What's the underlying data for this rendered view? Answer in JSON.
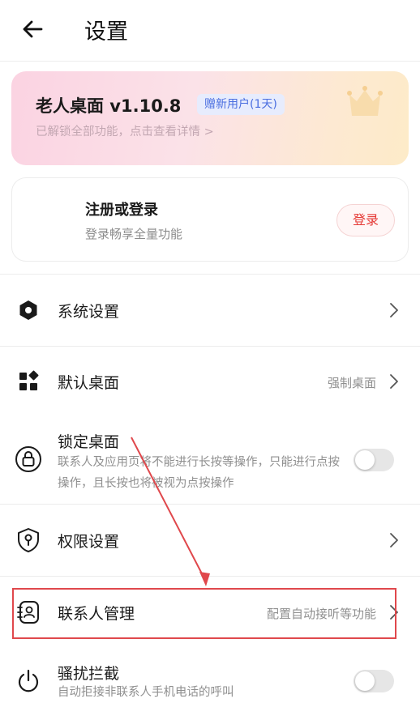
{
  "header": {
    "title": "设置",
    "back_icon": "arrow-left-icon"
  },
  "vip_card": {
    "title": "老人桌面 v1.10.8",
    "badge": "赠新用户(1天)",
    "subtitle": "已解锁全部功能，点击查看详情 >",
    "icon": "crown-icon"
  },
  "login_card": {
    "title": "注册或登录",
    "subtitle": "登录畅享全量功能",
    "button_label": "登录"
  },
  "settings": {
    "system": {
      "label": "系统设置",
      "icon": "hexagon-gear-icon"
    },
    "default_desktop": {
      "label": "默认桌面",
      "value": "强制桌面",
      "icon": "apps-grid-icon"
    },
    "lock_desktop": {
      "label": "锁定桌面",
      "desc": "联系人及应用页将不能进行长按等操作，只能进行点按操作，且长按也将被视为点按操作",
      "enabled": false,
      "icon": "lock-icon"
    },
    "permissions": {
      "label": "权限设置",
      "icon": "shield-key-icon"
    },
    "contacts": {
      "label": "联系人管理",
      "value": "配置自动接听等功能",
      "icon": "contact-book-icon"
    },
    "harassment": {
      "label": "骚扰拦截",
      "desc": "自动拒接非联系人手机电话的呼叫",
      "enabled": false,
      "icon": "power-icon"
    }
  },
  "colors": {
    "accent_red": "#e53935",
    "badge_blue": "#4a6ee0",
    "annotation_red": "#e0484c"
  }
}
